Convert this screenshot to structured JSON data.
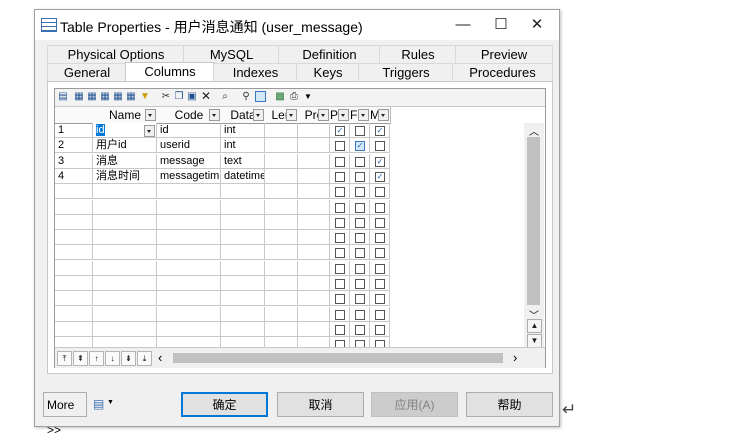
{
  "window": {
    "title": "Table Properties - 用户消息通知 (user_message)",
    "minimize": "—",
    "maximize": "☐",
    "close": "✕"
  },
  "tabs_top": [
    "Physical Options",
    "MySQL",
    "Definition",
    "Rules",
    "Preview"
  ],
  "tabs_bottom": [
    "General",
    "Columns",
    "Indexes",
    "Keys",
    "Triggers",
    "Procedures"
  ],
  "active_tab": "Columns",
  "grid": {
    "headers": [
      "Name",
      "Code",
      "Data",
      "Len",
      "Pre",
      "P",
      "F",
      "M"
    ],
    "rows": [
      {
        "num": "1",
        "name": "id",
        "code": "id",
        "data": "int",
        "p": true,
        "f": false,
        "m": true
      },
      {
        "num": "2",
        "name": "用户id",
        "code": "userid",
        "data": "int",
        "p": false,
        "f": true,
        "m": false
      },
      {
        "num": "3",
        "name": "消息",
        "code": "message",
        "data": "text",
        "p": false,
        "f": false,
        "m": true
      },
      {
        "num": "4",
        "name": "消息时间",
        "code": "messagetim",
        "data": "datetime",
        "p": false,
        "f": false,
        "m": true
      }
    ],
    "empty_row_count": 11
  },
  "buttons": {
    "more": "More >>",
    "ok": "确定",
    "cancel": "取消",
    "apply": "应用(A)",
    "help": "帮助"
  },
  "check_glyph": "✓",
  "outside_glyph": "↵"
}
